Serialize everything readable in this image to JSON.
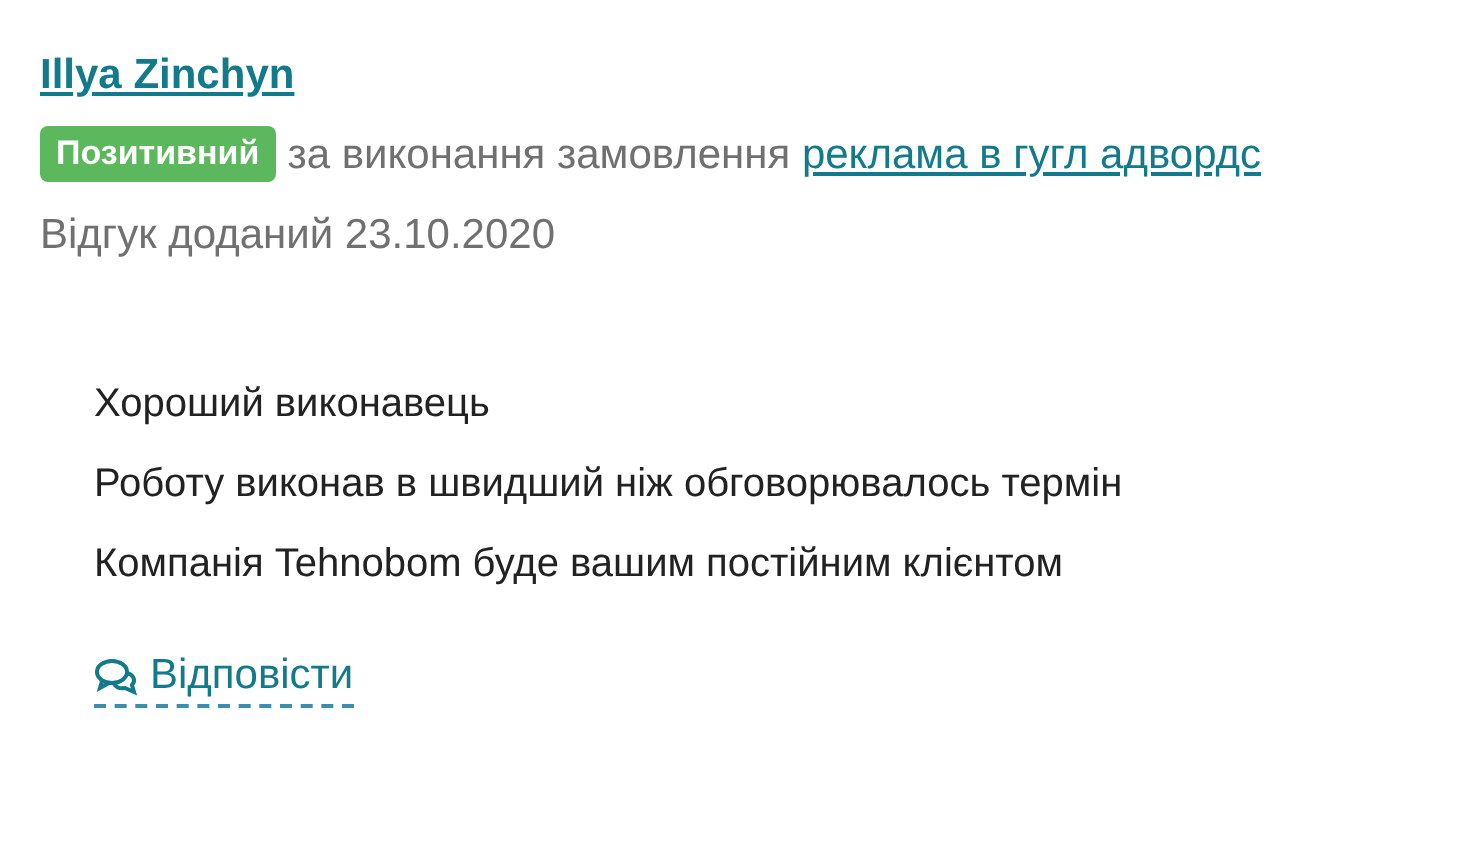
{
  "review": {
    "author": "Illya Zinchyn",
    "rating_badge": "Позитивний",
    "order_text": "за виконання замовлення",
    "order_link": "реклама в гугл адвордс",
    "date": "Відгук доданий 23.10.2020",
    "body_lines": [
      "Хороший виконавець",
      "Роботу виконав в швидший ніж обговорювалось термін",
      "Компанія Tehnobom буде вашим постійним клієнтом"
    ],
    "reply_link": "Відповісти"
  }
}
